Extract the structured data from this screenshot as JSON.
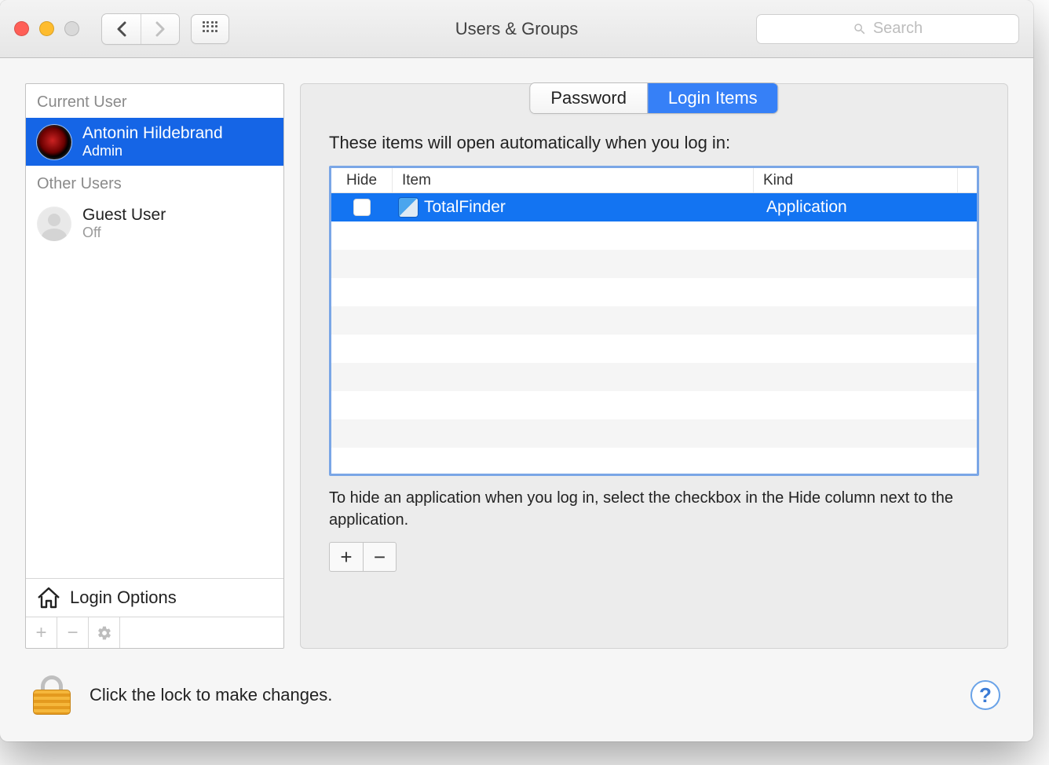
{
  "window": {
    "title": "Users & Groups"
  },
  "search": {
    "placeholder": "Search"
  },
  "sidebar": {
    "current_user_label": "Current User",
    "other_users_label": "Other Users",
    "login_options_label": "Login Options",
    "current_user": {
      "name": "Antonin Hildebrand",
      "role": "Admin"
    },
    "other_users": [
      {
        "name": "Guest User",
        "role": "Off"
      }
    ]
  },
  "tabs": {
    "password": "Password",
    "login_items": "Login Items"
  },
  "main": {
    "description": "These items will open automatically when you log in:",
    "columns": {
      "hide": "Hide",
      "item": "Item",
      "kind": "Kind"
    },
    "items": [
      {
        "name": "TotalFinder",
        "kind": "Application",
        "hide": false
      }
    ],
    "hint": "To hide an application when you log in, select the checkbox in the Hide column next to the application."
  },
  "footer": {
    "lock_text": "Click the lock to make changes."
  },
  "glyphs": {
    "plus": "+",
    "minus": "−",
    "help": "?"
  }
}
